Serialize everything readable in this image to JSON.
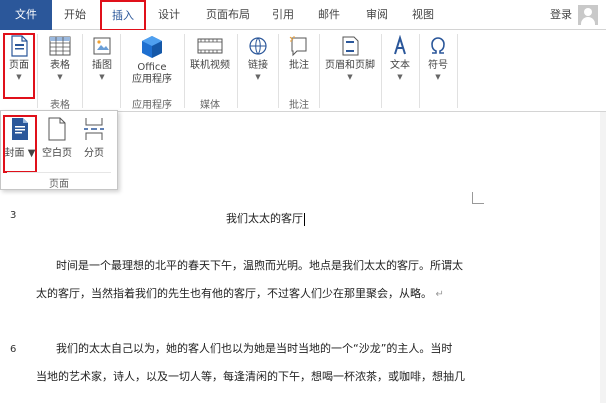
{
  "tabs": {
    "file": "文件",
    "home": "开始",
    "insert": "插入",
    "design": "设计",
    "layout": "页面布局",
    "references": "引用",
    "mailings": "邮件",
    "review": "审阅",
    "view": "视图"
  },
  "account": {
    "login": "登录"
  },
  "ribbon": {
    "pages_btn": "页面",
    "table_btn": "表格",
    "table_group": "表格",
    "illustrations_btn": "插图",
    "office_btn_line1": "Office",
    "office_btn_line2": "应用程序",
    "apps_group": "应用程序",
    "online_video_btn": "联机视频",
    "media_group": "媒体",
    "links_btn": "链接",
    "comment_btn": "批注",
    "comments_group": "批注",
    "header_footer_btn": "页眉和页脚",
    "text_btn": "文本",
    "symbols_btn": "符号"
  },
  "dropdown": {
    "cover": "封面",
    "blank_page": "空白页",
    "page_break": "分页",
    "group": "页面"
  },
  "document": {
    "title_linenum": "3",
    "title": "我们太太的客厅",
    "para1_line1": "时间是一个最理想的北平的春天下午，温煦而光明。地点是我们太太的客厅。所谓太",
    "para1_line2": "太的客厅，当然指着我们的先生也有他的客厅，不过客人们少在那里聚会，从略。",
    "para2_linenum": "6",
    "para2_line1": "我们的太太自己以为，她的客人们也以为她是当时当地的一个“沙龙”的主人。当时",
    "para2_line2": "当地的艺术家，诗人，以及一切人等，每逢清闲的下午，想喝一杯浓茶，或咖啡，想抽几"
  },
  "colors": {
    "file_tab": "#2b579a",
    "highlight": "#e0101a",
    "accent": "#2b579a"
  }
}
